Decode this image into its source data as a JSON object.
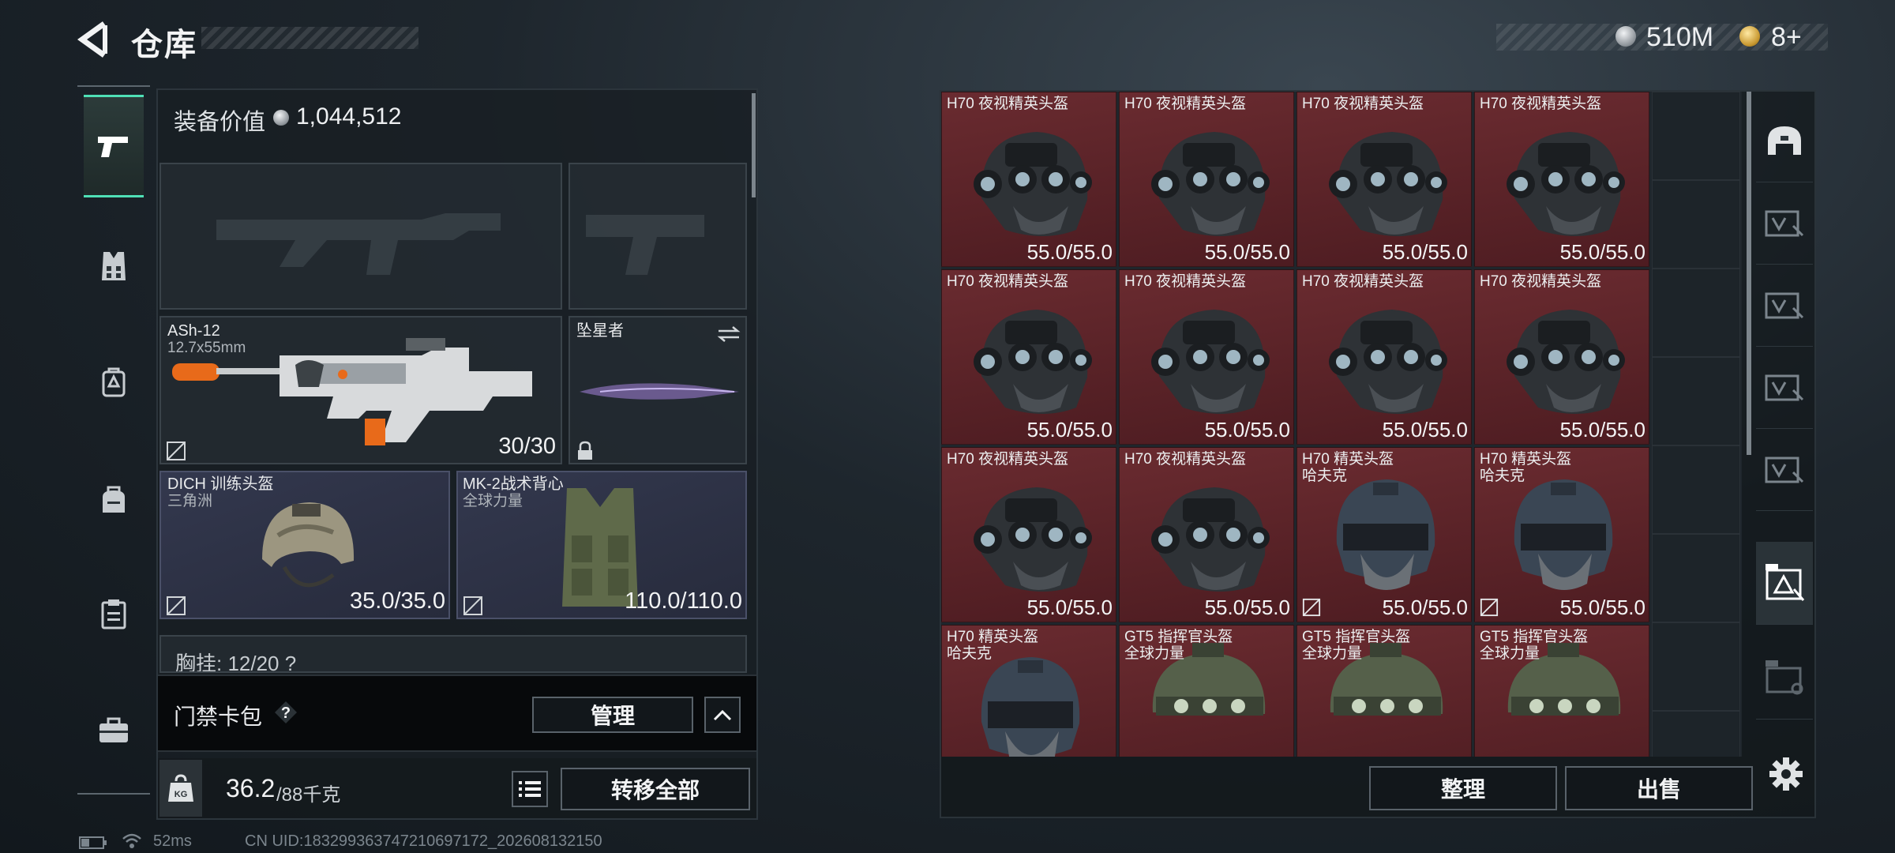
{
  "header": {
    "title": "仓库",
    "back_icon": "back-arrow-icon"
  },
  "currency": {
    "silver": "510M",
    "gold": "8+"
  },
  "sidebar": {
    "categories": [
      {
        "icon": "pistol-icon",
        "active": true
      },
      {
        "icon": "vest-icon",
        "active": false
      },
      {
        "icon": "backpack-icon",
        "active": false
      },
      {
        "icon": "bag-icon",
        "active": false
      },
      {
        "icon": "clipboard-icon",
        "active": false
      },
      {
        "icon": "briefcase-icon",
        "active": false
      }
    ]
  },
  "loadout": {
    "equip_value_label": "装备价值",
    "equip_value": "1,044,512",
    "primary_weapon": {
      "name": "ASh-12",
      "ammo": "12.7x55mm",
      "mag": "30/30"
    },
    "melee": {
      "name": "坠星者"
    },
    "helmet": {
      "name": "DICH 训练头盔",
      "brand": "三角洲",
      "durability": "35.0/35.0"
    },
    "armor": {
      "name": "MK-2战术背心",
      "brand": "全球力量",
      "durability": "110.0/110.0"
    },
    "chest_rig_peek": "胸挂: 12/20 ?",
    "access_card_label": "门禁卡包",
    "access_help": "?",
    "manage_label": "管理",
    "weight_current": "36.2",
    "weight_max": "/88千克",
    "weight_icon_text": "KG",
    "transfer_all_label": "转移全部"
  },
  "stash": {
    "items": [
      {
        "name": "H70 夜视精英头盔",
        "sub": "",
        "durability": "55.0/55.0",
        "kind": "nv",
        "flag": false
      },
      {
        "name": "H70 夜视精英头盔",
        "sub": "",
        "durability": "55.0/55.0",
        "kind": "nv",
        "flag": false
      },
      {
        "name": "H70 夜视精英头盔",
        "sub": "",
        "durability": "55.0/55.0",
        "kind": "nv",
        "flag": false
      },
      {
        "name": "H70 夜视精英头盔",
        "sub": "",
        "durability": "55.0/55.0",
        "kind": "nv",
        "flag": false
      },
      {
        "name": "H70 夜视精英头盔",
        "sub": "",
        "durability": "55.0/55.0",
        "kind": "nv",
        "flag": false
      },
      {
        "name": "H70 夜视精英头盔",
        "sub": "",
        "durability": "55.0/55.0",
        "kind": "nv",
        "flag": false
      },
      {
        "name": "H70 夜视精英头盔",
        "sub": "",
        "durability": "55.0/55.0",
        "kind": "nv",
        "flag": false
      },
      {
        "name": "H70 夜视精英头盔",
        "sub": "",
        "durability": "55.0/55.0",
        "kind": "nv",
        "flag": false
      },
      {
        "name": "H70 夜视精英头盔",
        "sub": "",
        "durability": "55.0/55.0",
        "kind": "nv",
        "flag": false
      },
      {
        "name": "H70 夜视精英头盔",
        "sub": "",
        "durability": "55.0/55.0",
        "kind": "nv",
        "flag": false
      },
      {
        "name": "H70 精英头盔",
        "sub": "哈夫克",
        "durability": "55.0/55.0",
        "kind": "elite",
        "flag": true
      },
      {
        "name": "H70 精英头盔",
        "sub": "哈夫克",
        "durability": "55.0/55.0",
        "kind": "elite",
        "flag": true
      },
      {
        "name": "H70 精英头盔",
        "sub": "哈夫克",
        "durability": "",
        "kind": "elite",
        "flag": false
      },
      {
        "name": "GT5 指挥官头盔",
        "sub": "全球力量",
        "durability": "",
        "kind": "gt5",
        "flag": false
      },
      {
        "name": "GT5 指挥官头盔",
        "sub": "全球力量",
        "durability": "",
        "kind": "gt5",
        "flag": false
      },
      {
        "name": "GT5 指挥官头盔",
        "sub": "全球力量",
        "durability": "",
        "kind": "gt5",
        "flag": false
      }
    ],
    "filters": [
      "helmet-filter-icon",
      "armor-filter-icon",
      "armor-filter-icon",
      "armor-filter-icon",
      "armor-filter-icon",
      "gti-armor-filter-icon",
      "gti-case-filter-icon"
    ],
    "sort_label": "整理",
    "sell_label": "出售"
  },
  "status": {
    "ping": "52ms",
    "uid": "CN UID:1832993637472106971​72_202608132150",
    "hint": "· · ·"
  },
  "colors": {
    "accent": "#4fe0b6",
    "rare_red": "#6a2b30",
    "epic_blue": "#33384e"
  }
}
